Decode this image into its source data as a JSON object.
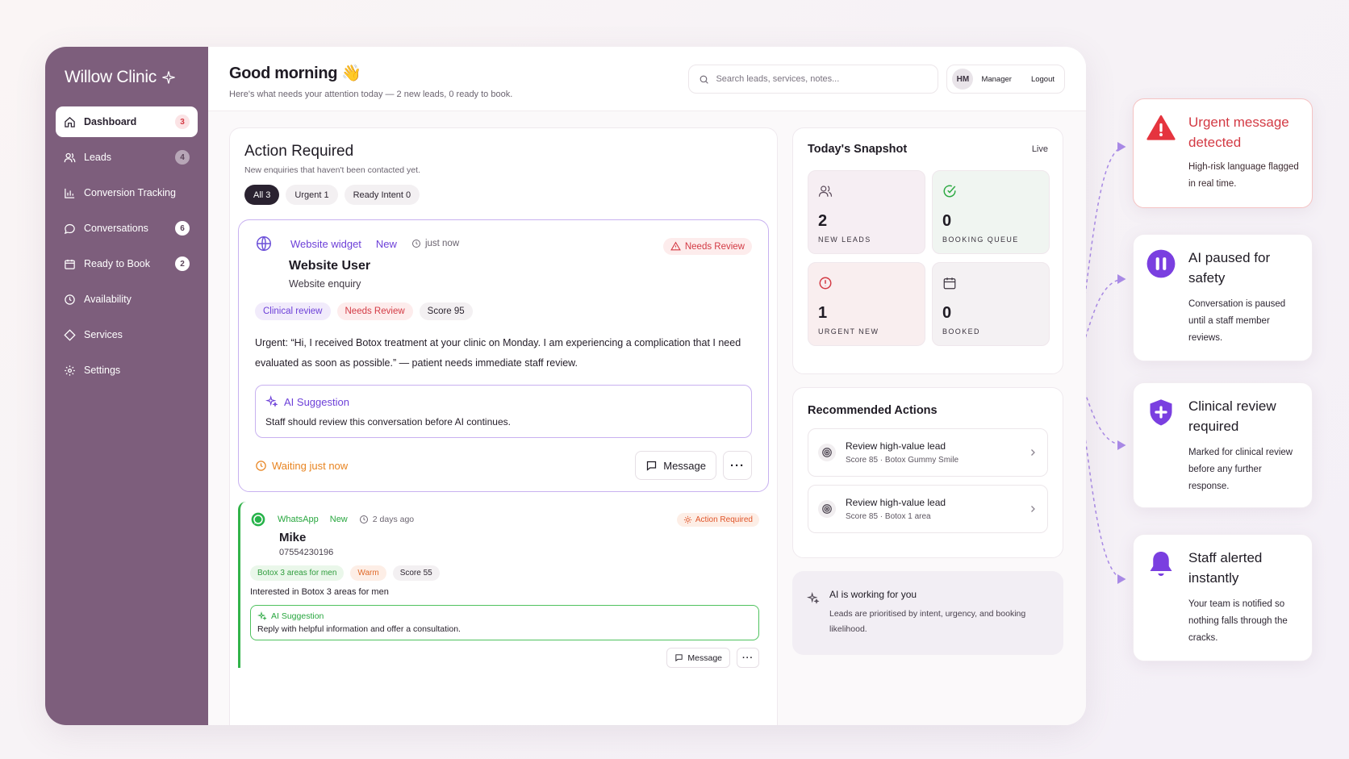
{
  "brand": "Willow Clinic",
  "sidebar": {
    "items": [
      {
        "label": "Dashboard",
        "badge": "3"
      },
      {
        "label": "Leads",
        "badge": "4"
      },
      {
        "label": "Conversion Tracking",
        "badge": ""
      },
      {
        "label": "Conversations",
        "badge": "6"
      },
      {
        "label": "Ready to Book",
        "badge": "2"
      },
      {
        "label": "Availability",
        "badge": ""
      },
      {
        "label": "Services",
        "badge": ""
      },
      {
        "label": "Settings",
        "badge": ""
      }
    ]
  },
  "header": {
    "greeting": "Good morning 👋",
    "subtitle": "Here's what needs your attention today — 2 new leads, 0 ready to book.",
    "search_placeholder": "Search leads, services, notes...",
    "user_initials": "HM",
    "user_role": "Manager",
    "logout": "Logout"
  },
  "action": {
    "title": "Action Required",
    "subtitle": "New enquiries that haven't been contacted yet.",
    "filters": [
      "All 3",
      "Urgent 1",
      "Ready Intent 0"
    ]
  },
  "lead1": {
    "source": "Website widget",
    "status": "New",
    "time": "just now",
    "badge": "Needs Review",
    "name": "Website User",
    "sub": "Website enquiry",
    "tags": [
      "Clinical review",
      "Needs Review",
      "Score 95"
    ],
    "body": "Urgent: “Hi, I received Botox treatment at your clinic on Monday. I am experiencing a complication that I need evaluated as soon as possible.” — patient needs immediate staff review.",
    "ai_title": "AI Suggestion",
    "ai_text": "Staff should review this conversation before AI continues.",
    "waiting": "Waiting just now",
    "message": "Message",
    "more": "···"
  },
  "lead2": {
    "source": "WhatsApp",
    "status": "New",
    "time": "2 days ago",
    "badge": "Action Required",
    "name": "Mike",
    "phone": "07554230196",
    "tags": [
      "Botox 3 areas for men",
      "Warm",
      "Score 55"
    ],
    "body": "Interested in Botox 3 areas for men",
    "ai_title": "AI Suggestion",
    "ai_text": "Reply with helpful information and offer a consultation.",
    "message": "Message",
    "more": "···"
  },
  "snapshot": {
    "title": "Today's Snapshot",
    "live": "Live",
    "stats": [
      {
        "num": "2",
        "cap": "NEW LEADS"
      },
      {
        "num": "0",
        "cap": "BOOKING QUEUE"
      },
      {
        "num": "1",
        "cap": "URGENT NEW"
      },
      {
        "num": "0",
        "cap": "BOOKED"
      }
    ]
  },
  "recommended": {
    "title": "Recommended Actions",
    "items": [
      {
        "title": "Review high-value lead",
        "sub": "Score 85 · Botox Gummy Smile"
      },
      {
        "title": "Review high-value lead",
        "sub": "Score 85 · Botox 1 area"
      }
    ]
  },
  "ai_working": {
    "title": "AI is working for you",
    "text": "Leads are prioritised by intent, urgency, and booking likelihood."
  },
  "callouts": [
    {
      "title": "Urgent message detected",
      "text": "High-risk language flagged in real time."
    },
    {
      "title": "AI paused for safety",
      "text": "Conversation is paused until a staff member reviews."
    },
    {
      "title": "Clinical review required",
      "text": "Marked for clinical review before any further response."
    },
    {
      "title": "Staff alerted instantly",
      "text": "Your team is notified so nothing falls through the cracks."
    }
  ]
}
